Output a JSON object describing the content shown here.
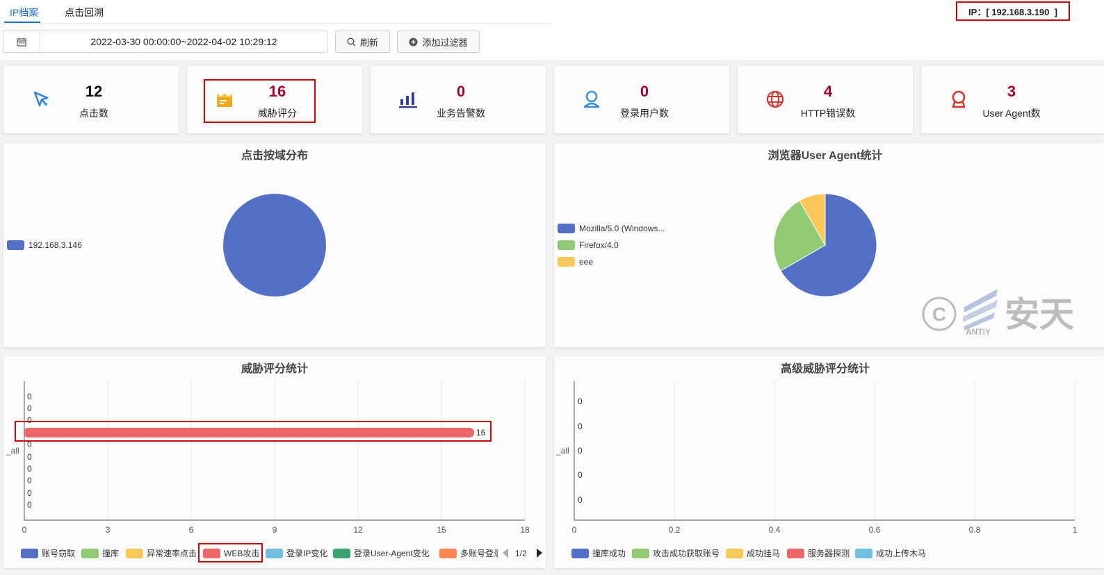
{
  "tabs": [
    {
      "label": "IP档案"
    },
    {
      "label": "点击回溯"
    }
  ],
  "ip_label": "IP：[ 192.168.3.190  ]",
  "filter": {
    "date_range": "2022-03-30 00:00:00~2022-04-02 10:29:12",
    "refresh_label": "刷新",
    "add_filter_label": "添加过滤器"
  },
  "stats": [
    {
      "value": "12",
      "label": "点击数",
      "icon": "cursor-icon"
    },
    {
      "value": "16",
      "label": "威胁评分",
      "icon": "folder-icon"
    },
    {
      "value": "0",
      "label": "业务告警数",
      "icon": "bar-chart-icon"
    },
    {
      "value": "0",
      "label": "登录用户数",
      "icon": "user-icon"
    },
    {
      "value": "4",
      "label": "HTTP错误数",
      "icon": "globe-icon"
    },
    {
      "value": "3",
      "label": "User Agent数",
      "icon": "agent-icon"
    }
  ],
  "colors": {
    "blue": "#5470c6",
    "green": "#91cc75",
    "yellow": "#fac858",
    "red": "#ee6666",
    "cyan": "#73c0de",
    "darkgreen": "#3ba272",
    "orange": "#fc8452",
    "accent": "#1e6fd0",
    "value_red": "#a4002a"
  },
  "watermark": {
    "brand_en": "ANTIY",
    "brand_cn": "安天"
  },
  "chart_data": [
    {
      "type": "pie",
      "title": "点击按域分布",
      "legend": [
        "192.168.3.146"
      ],
      "values": [
        12
      ],
      "legend_position": "left"
    },
    {
      "type": "pie",
      "title": "浏览器User Agent统计",
      "legend": [
        "Mozilla/5.0 (Windows...",
        "Firefox/4.0",
        "eee"
      ],
      "values": [
        2,
        0.75,
        0.25
      ],
      "legend_position": "left"
    },
    {
      "type": "bar",
      "orientation": "horizontal",
      "title": "威胁评分统计",
      "ylabel": "_all",
      "xlim": [
        0,
        18
      ],
      "xticks": [
        "0",
        "3",
        "6",
        "9",
        "12",
        "15",
        "18"
      ],
      "series": [
        {
          "name": "账号窃取",
          "values": [
            0
          ]
        },
        {
          "name": "撞库",
          "values": [
            0
          ]
        },
        {
          "name": "异常速率点击",
          "values": [
            0
          ]
        },
        {
          "name": "WEB攻击",
          "values": [
            16
          ]
        },
        {
          "name": "登录IP变化",
          "values": [
            0
          ]
        },
        {
          "name": "登录User-Agent变化",
          "values": [
            0
          ]
        },
        {
          "name": "多账号登录",
          "values": [
            0
          ]
        },
        {
          "name": "",
          "values": [
            0
          ]
        },
        {
          "name": "",
          "values": [
            0
          ]
        },
        {
          "name": "",
          "values": [
            0
          ]
        },
        {
          "name": "",
          "values": [
            0
          ]
        }
      ],
      "zero_labels": [
        "0",
        "0",
        "0",
        "0",
        "0",
        "0",
        "0",
        "0",
        "0",
        "0"
      ],
      "highlight_label": "16",
      "legend_display": [
        "账号窃取",
        "撞库",
        "异常速率点击",
        "WEB攻击",
        "登录IP变化",
        "登录User-Agent变化",
        "多账号登录"
      ],
      "legend_page": "1/2"
    },
    {
      "type": "bar",
      "orientation": "horizontal",
      "title": "高级威胁评分统计",
      "ylabel": "_all",
      "xlim": [
        0,
        1
      ],
      "xticks": [
        "0",
        "0.2",
        "0.4",
        "0.6",
        "0.8",
        "1"
      ],
      "series": [
        {
          "name": "撞库成功",
          "values": [
            0
          ]
        },
        {
          "name": "攻击成功获取账号",
          "values": [
            0
          ]
        },
        {
          "name": "成功挂马",
          "values": [
            0
          ]
        },
        {
          "name": "服务器探测",
          "values": [
            0
          ]
        },
        {
          "name": "成功上传木马",
          "values": [
            0
          ]
        }
      ],
      "zero_labels": [
        "0",
        "0",
        "0",
        "0",
        "0"
      ]
    }
  ]
}
